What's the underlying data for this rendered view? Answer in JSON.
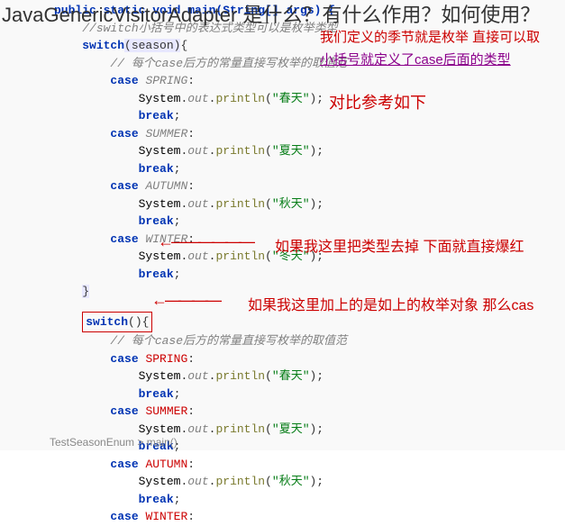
{
  "question": "JavaGenericVisitorAdapter 是什么？有什么作用？如何使用？",
  "code": {
    "sig": "public static void main(String[] args) {",
    "comment1": "//switch小括号中的表达式类型可以是枚举类型",
    "switch1": "switch",
    "switch1_arg": "(season)",
    "switch1_brace": "{",
    "comment2": "// 每个case后方的常量直接写枚举的取值范",
    "cases": [
      {
        "label": "SPRING",
        "text": "\"春天\""
      },
      {
        "label": "SUMMER",
        "text": "\"夏天\""
      },
      {
        "label": "AUTUMN",
        "text": "\"秋天\""
      },
      {
        "label": "WINTER",
        "text": "\"冬天\""
      }
    ],
    "case_kw": "case",
    "break_kw": "break",
    "system": "System",
    "out": "out",
    "println": "println",
    "close_brace": "}",
    "switch2": "switch",
    "switch2_arg": "(){",
    "comment3": "// 每个case后方的常量直接写枚举的取值范"
  },
  "annotations": {
    "a1": "我们定义的季节就是枚举 直接可以取",
    "a2": "小括号就定义了case后面的类型",
    "a3": "对比参考如下",
    "a4": "如果我这里把类型去掉 下面就直接爆红",
    "a5": "如果我这里加上的是如上的枚举对象  那么cas"
  },
  "breadcrumb": "TestSeasonEnum > main()"
}
